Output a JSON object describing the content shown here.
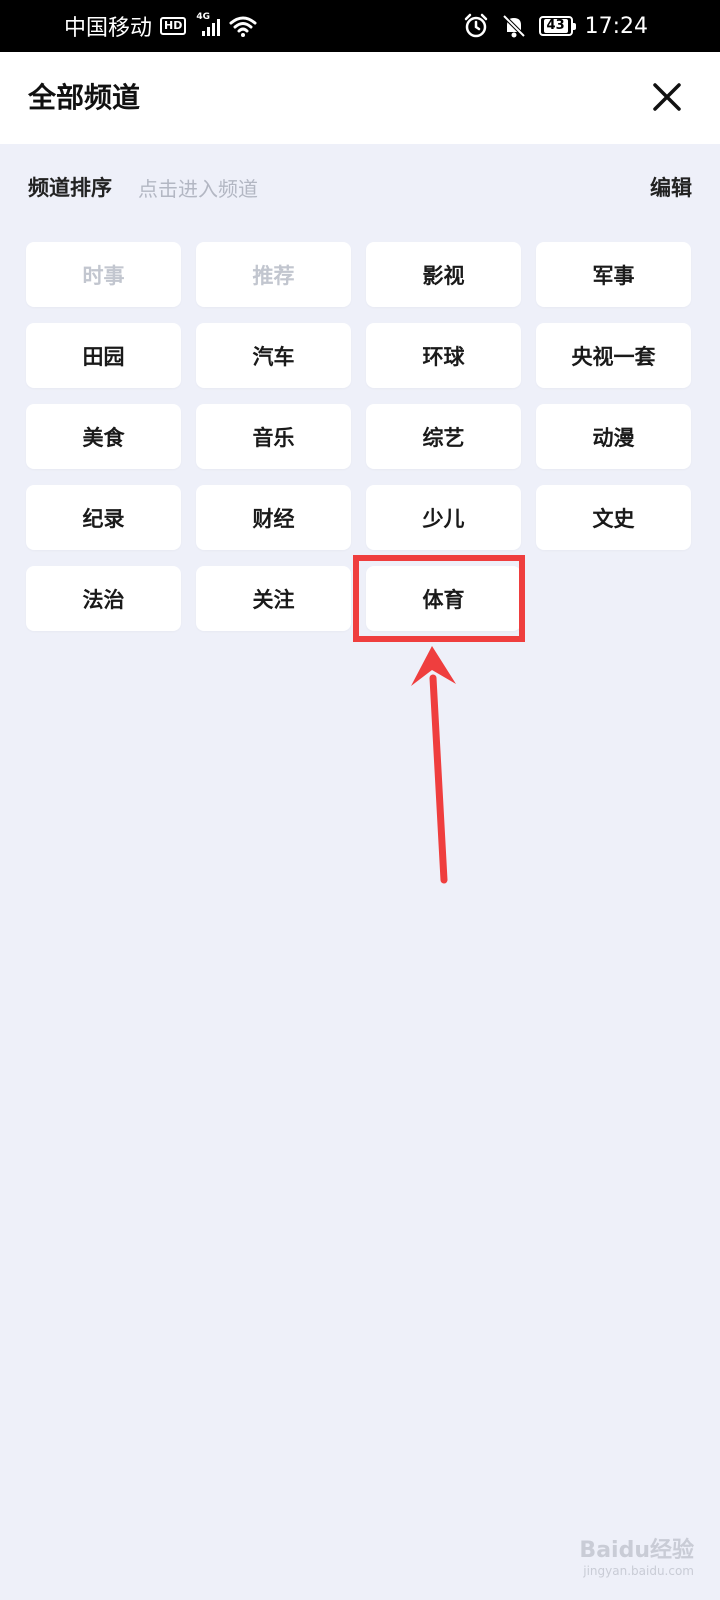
{
  "status": {
    "carrier": "中国移动",
    "hd": "HD",
    "network": "4G",
    "battery": "43",
    "time": "17:24"
  },
  "header": {
    "title": "全部频道"
  },
  "section": {
    "title": "频道排序",
    "hint": "点击进入频道",
    "edit": "编辑"
  },
  "channels": [
    {
      "label": "时事",
      "fixed": true
    },
    {
      "label": "推荐",
      "fixed": true
    },
    {
      "label": "影视",
      "fixed": false
    },
    {
      "label": "军事",
      "fixed": false
    },
    {
      "label": "田园",
      "fixed": false
    },
    {
      "label": "汽车",
      "fixed": false
    },
    {
      "label": "环球",
      "fixed": false
    },
    {
      "label": "央视一套",
      "fixed": false
    },
    {
      "label": "美食",
      "fixed": false
    },
    {
      "label": "音乐",
      "fixed": false
    },
    {
      "label": "综艺",
      "fixed": false
    },
    {
      "label": "动漫",
      "fixed": false
    },
    {
      "label": "纪录",
      "fixed": false
    },
    {
      "label": "财经",
      "fixed": false
    },
    {
      "label": "少儿",
      "fixed": false
    },
    {
      "label": "文史",
      "fixed": false
    },
    {
      "label": "法治",
      "fixed": false
    },
    {
      "label": "关注",
      "fixed": false
    },
    {
      "label": "体育",
      "fixed": false
    }
  ],
  "annotation": {
    "highlight_color": "#ef3e3e",
    "highlighted_channel": "体育"
  },
  "watermark": {
    "text": "Baidu经验",
    "sub": "jingyan.baidu.com"
  }
}
